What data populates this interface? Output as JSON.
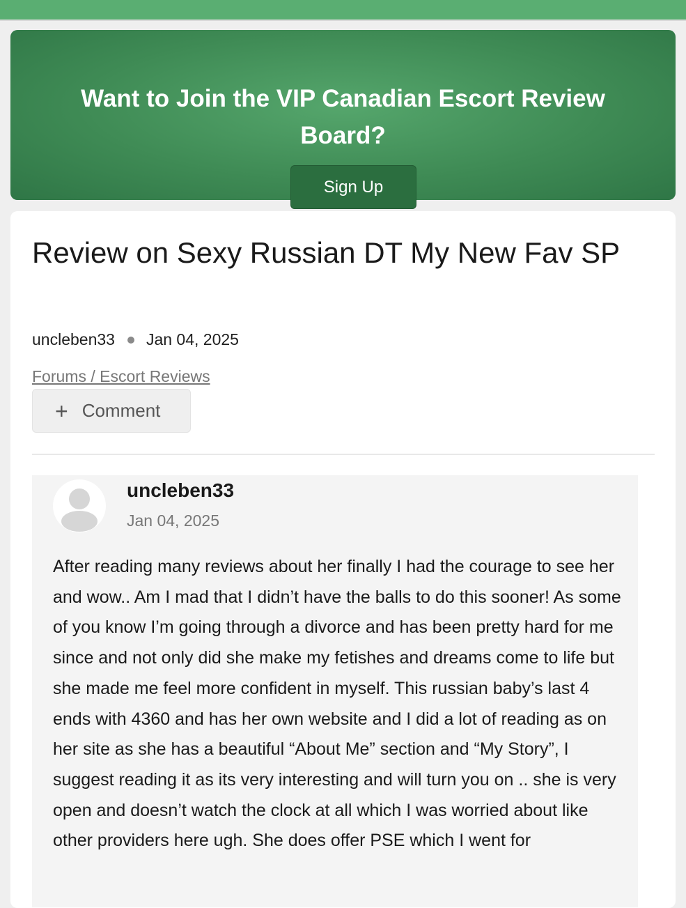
{
  "banner": {
    "title": "Want to Join the VIP Canadian Escort Review Board?",
    "signup_label": "Sign Up"
  },
  "post": {
    "title": "Review on Sexy Russian DT My New Fav SP",
    "author": "uncleben33",
    "date": "Jan 04, 2025",
    "breadcrumb": "Forums / Escort Reviews",
    "comment_label": "Comment"
  },
  "reply": {
    "author": "uncleben33",
    "date": "Jan 04, 2025",
    "body": "After reading many reviews about her finally I had the courage to see her and wow.. Am I mad that I didn’t have the balls to do this sooner! As some of you know I’m going through a divorce and has been pretty hard for me since and not only did she make my fetishes and dreams come to life but she made me feel more confident in myself. This russian baby’s last 4 ends with 4360 and has her own website and I did a lot of reading as on her site as she has a beautiful “About Me” section and “My Story”, I suggest reading it as its very interesting and will turn you on .. she is very open and doesn’t watch the clock at all which I was worried about like other providers here ugh. She does offer PSE which I went for"
  },
  "colors": {
    "topbar": "#5aae72",
    "banner": "#3f8b55",
    "signup_button": "#2b6e3f"
  }
}
